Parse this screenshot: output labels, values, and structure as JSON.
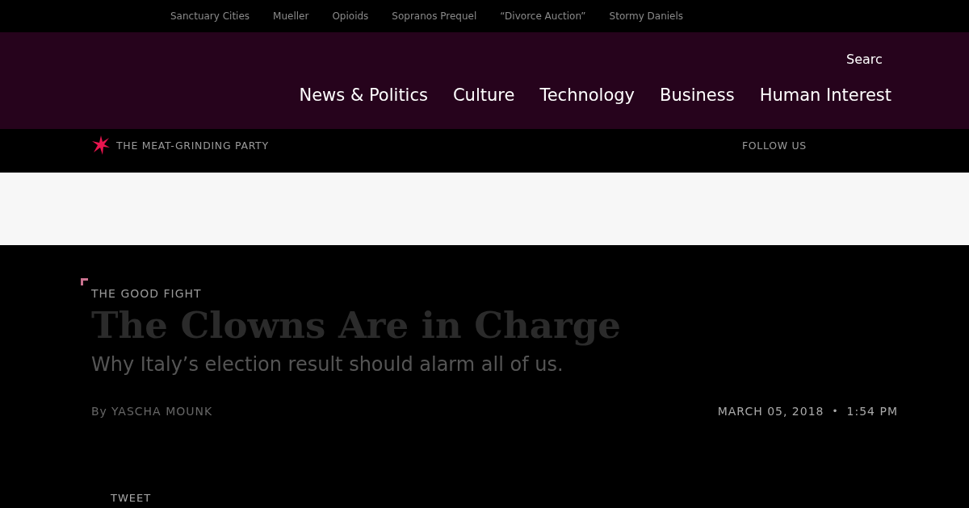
{
  "trending": [
    "Sanctuary Cities",
    "Mueller",
    "Opioids",
    "Sopranos Prequel",
    "“Divorce Auction”",
    "Stormy Daniels"
  ],
  "search": {
    "placeholder": "Searc"
  },
  "nav": [
    "News & Politics",
    "Culture",
    "Technology",
    "Business",
    "Human Interest"
  ],
  "series": "THE MEAT-GRINDING PARTY",
  "follow": "FOLLOW US",
  "article": {
    "kicker": "THE GOOD FIGHT",
    "title": "The Clowns Are in Charge",
    "dek": "Why Italy’s election result should alarm all of us.",
    "by": "By",
    "author": "YASCHA MOUNK",
    "date": "MARCH 05, 2018",
    "sep": "•",
    "time": "1:54 PM",
    "share": "TWEET"
  }
}
